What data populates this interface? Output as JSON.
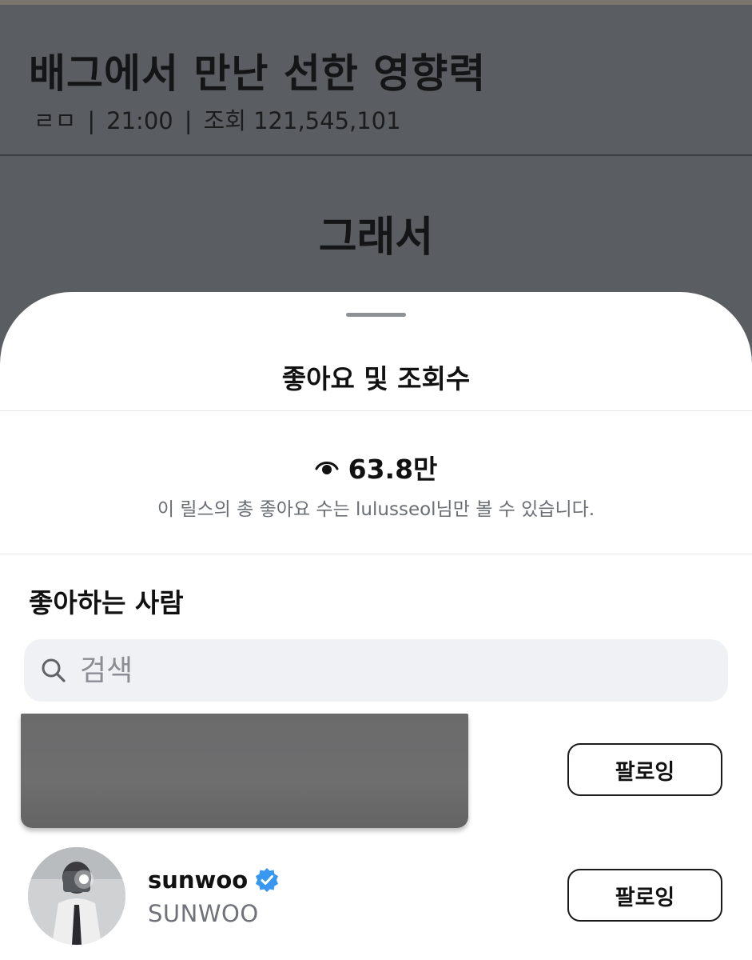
{
  "post": {
    "title": "배그에서 만난 선한 영향력",
    "author": "ㄹㅁ",
    "time": "21:00",
    "views_label": "조회 121,545,101",
    "subtitle": "그래서"
  },
  "sheet": {
    "title": "좋아요 및 조회수",
    "views_icon": "eye-icon",
    "views_count": "63.8만",
    "views_note": "이 릴스의 총 좋아요 수는 lulusseol님만 볼 수 있습니다.",
    "likers_heading": "좋아하는 사람",
    "search": {
      "placeholder": "검색",
      "icon": "search-icon"
    },
    "users": [
      {
        "redacted": true,
        "button_label": "팔로잉"
      },
      {
        "username": "sunwoo",
        "verified": true,
        "full_name": "SUNWOO",
        "button_label": "팔로잉"
      }
    ]
  },
  "colors": {
    "overlay": "#5a5d61",
    "sheet_bg": "#ffffff",
    "verified": "#3897f0",
    "search_bg": "#eff1f4"
  }
}
